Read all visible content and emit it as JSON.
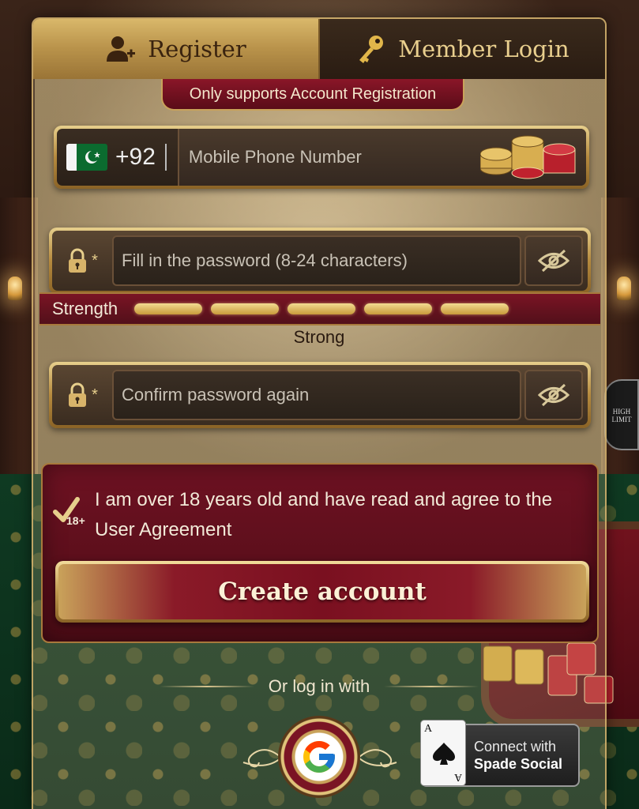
{
  "tabs": {
    "register_label": "Register",
    "login_label": "Member Login"
  },
  "notice": "Only supports Account Registration",
  "phone": {
    "country_flag": "pakistan-flag-icon",
    "dial_code": "+92",
    "placeholder": "Mobile Phone Number",
    "value": ""
  },
  "password": {
    "required_mark": "*",
    "placeholder": "Fill in the password (8-24 characters)",
    "value": ""
  },
  "strength": {
    "label": "Strength",
    "segments": 5,
    "filled": 5,
    "status": "Strong"
  },
  "confirm": {
    "required_mark": "*",
    "placeholder": "Confirm password again",
    "value": ""
  },
  "agreement": {
    "badge": "18+",
    "text": "I am over 18 years old and have read and agree to the User Agreement",
    "checked": true
  },
  "create_button": "Create account",
  "social": {
    "divider_text": "Or log in with",
    "google_icon": "google-icon",
    "spade_line1": "Connect with",
    "spade_line2": "Spade Social",
    "card_rank": "A"
  },
  "background": {
    "table_sign": "HIGH LIMIT"
  },
  "colors": {
    "gold": "#c9a25a",
    "burgundy": "#7a1424",
    "dark_field": "#2a2018"
  }
}
